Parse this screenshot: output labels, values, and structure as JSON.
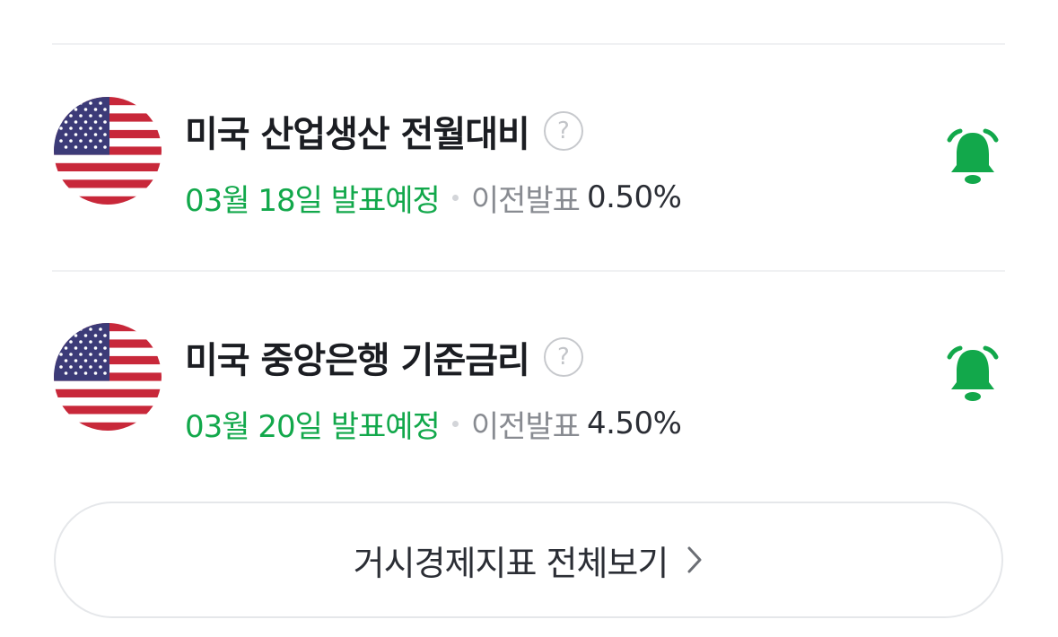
{
  "indicators": [
    {
      "country_flag": "us-flag-icon",
      "title": "미국 산업생산 전월대비",
      "release_date": "03월 18일 발표예정",
      "previous_label": "이전발표",
      "previous_value": "0.50%",
      "help_icon": "?",
      "alert_icon": "bell-icon"
    },
    {
      "country_flag": "us-flag-icon",
      "title": "미국 중앙은행 기준금리",
      "release_date": "03월 20일 발표예정",
      "previous_label": "이전발표",
      "previous_value": "4.50%",
      "help_icon": "?",
      "alert_icon": "bell-icon"
    }
  ],
  "footer": {
    "view_all_label": "거시경제지표 전체보기"
  },
  "colors": {
    "accent_green": "#12a84b",
    "title_text": "#1b1d22",
    "muted_text": "#888b91",
    "divider": "#f0f1f3"
  }
}
